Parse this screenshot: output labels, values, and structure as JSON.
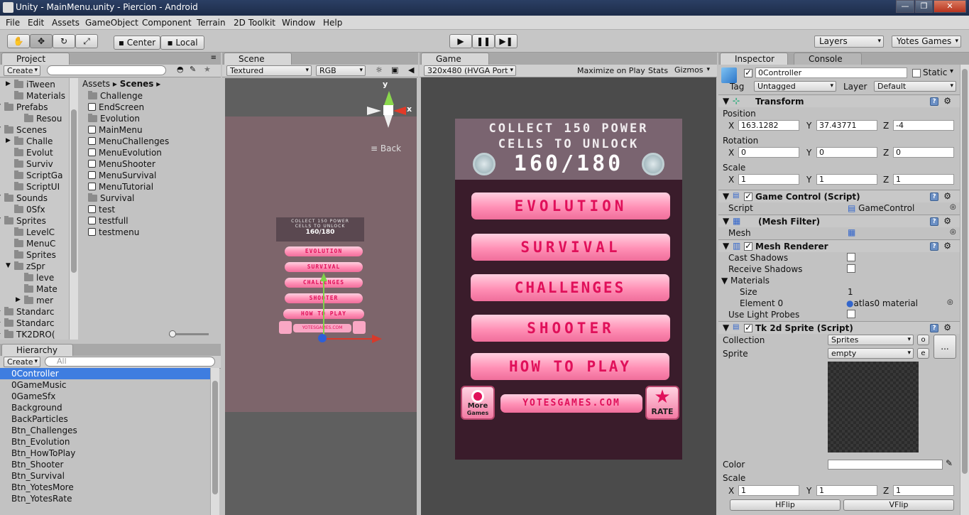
{
  "window": {
    "title": "Unity - MainMenu.unity - Piercion - Android",
    "controls": [
      "—",
      "❐",
      "✕"
    ]
  },
  "menu": [
    "File",
    "Edit",
    "Assets",
    "GameObject",
    "Component",
    "Terrain",
    "2D Toolkit",
    "Window",
    "Help"
  ],
  "toolbar": {
    "pivot": "Center",
    "space": "Local",
    "layers": "Layers",
    "layout": "Yotes Games"
  },
  "project": {
    "tab": "Project",
    "create": "Create",
    "tree": [
      "iTween",
      "Materials",
      "Prefabs",
      "Resou",
      "Scenes",
      "Challe",
      "Evolut",
      "Surviv",
      "ScriptGa",
      "ScriptUI",
      "Sounds",
      "0Sfx",
      "Sprites",
      "LevelC",
      "MenuC",
      "Sprites",
      "zSpr",
      "leve",
      "Mate",
      "mer",
      "Standarc",
      "Standarc",
      "TK2DRO("
    ],
    "breadcrumb": [
      "Assets",
      "Scenes"
    ],
    "files": [
      "Challenge",
      "EndScreen",
      "Evolution",
      "MainMenu",
      "MenuChallenges",
      "MenuEvolution",
      "MenuShooter",
      "MenuSurvival",
      "MenuTutorial",
      "Survival",
      "test",
      "testfull",
      "testmenu"
    ]
  },
  "hierarchy": {
    "tab": "Hierarchy",
    "create": "Create",
    "search_placeholder": "All",
    "items": [
      "0Controller",
      "0GameMusic",
      "0GameSfx",
      "Background",
      "BackParticles",
      "Btn_Challenges",
      "Btn_Evolution",
      "Btn_HowToPlay",
      "Btn_Shooter",
      "Btn_Survival",
      "Btn_YotesMore",
      "Btn_YotesRate"
    ]
  },
  "scene": {
    "tab": "Scene",
    "shading": "Textured",
    "render": "RGB",
    "back": "Back",
    "axis_x": "x",
    "axis_y": "y"
  },
  "game": {
    "tab": "Game",
    "aspect": "320x480 (HVGA Port",
    "maximize": "Maximize on Play",
    "stats": "Stats",
    "gizmos": "Gizmos",
    "header_line1": "COLLECT 150 POWER",
    "header_line2": "CELLS TO UNLOCK",
    "counter": "160/180",
    "buttons": [
      "EVOLUTION",
      "SURVIVAL",
      "CHALLENGES",
      "SHOOTER",
      "HOW TO PLAY"
    ],
    "more_line1": "More",
    "more_line2": "Games",
    "site": "YOTESGAMES.COM",
    "rate": "RATE"
  },
  "inspector": {
    "tab": "Inspector",
    "console_tab": "Console",
    "name": "0Controller",
    "static": "Static",
    "tag_label": "Tag",
    "tag": "Untagged",
    "layer_label": "Layer",
    "layer": "Default",
    "transform": {
      "title": "Transform",
      "position": "Position",
      "rotation": "Rotation",
      "scale": "Scale",
      "pos": [
        "163.1282",
        "37.43771",
        "-4"
      ],
      "rot": [
        "0",
        "0",
        "0"
      ],
      "scl": [
        "1",
        "1",
        "1"
      ]
    },
    "game_control": {
      "title": "Game Control (Script)",
      "script_label": "Script",
      "script": "GameControl"
    },
    "mesh_filter": {
      "title": "(Mesh Filter)",
      "mesh_label": "Mesh"
    },
    "mesh_renderer": {
      "title": "Mesh Renderer",
      "cast": "Cast Shadows",
      "receive": "Receive Shadows",
      "materials": "Materials",
      "size_label": "Size",
      "size": "1",
      "element_label": "Element 0",
      "element": "atlas0 material",
      "probes": "Use Light Probes"
    },
    "sprite": {
      "title": "Tk 2d Sprite (Script)",
      "collection_label": "Collection",
      "collection": "Sprites",
      "sprite_label": "Sprite",
      "sprite": "empty",
      "o_btn": "o",
      "e_btn": "e",
      "dots": "...",
      "color": "Color",
      "scale": "Scale",
      "scl": [
        "1",
        "1",
        "1"
      ],
      "hflip": "HFlip",
      "vflip": "VFlip"
    },
    "axes": [
      "X",
      "Y",
      "Z"
    ]
  }
}
